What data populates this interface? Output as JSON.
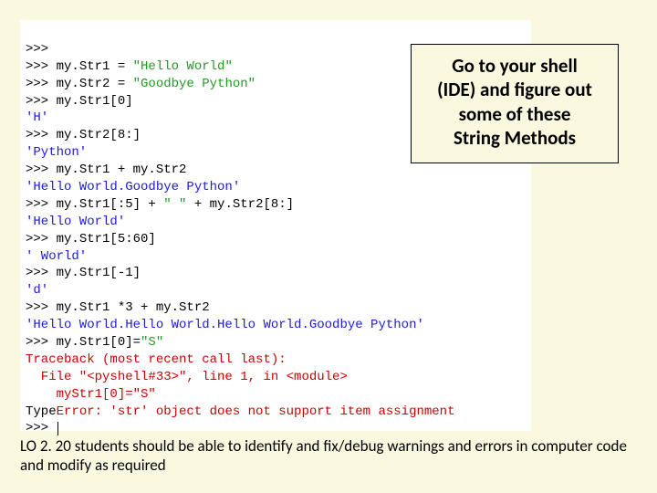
{
  "code": {
    "prompt": ">>> ",
    "l1a": "my.Str1 = ",
    "l1b": "\"Hello World\"",
    "l2a": "my.Str2 = ",
    "l2b": "\"Goodbye Python\"",
    "l3": "my.Str1[0]",
    "o3": "'H'",
    "l4": "my.Str2[8:]",
    "o4": "'Python'",
    "l5": "my.Str1 + my.Str2",
    "o5": "'Hello World.Goodbye Python'",
    "l6a": "my.Str1[:5] + ",
    "l6b": "\" \"",
    "l6c": " + my.Str2[8:]",
    "o6": "'Hello World'",
    "l7": "my.Str1[5:60]",
    "o7": "' World'",
    "l8": "my.Str1[-1]",
    "o8": "'d'",
    "l9": "my.Str1 *3 + my.Str2",
    "o9": "'Hello World.Hello World.Hello World.Goodbye Python'",
    "l10a": "my.Str1[0]=",
    "l10b": "\"S\"",
    "err1": "Traceback (most recent call last):",
    "err2": "  File \"<pyshell#33>\", line 1, in <module>",
    "err3": "    myStr1[0]=\"S\"",
    "err4a": "Type",
    "err4b": "Error: 'str' object does not support item assignment"
  },
  "callout": {
    "line1": "Go to your shell",
    "line2": "(IDE) and figure out",
    "line3": "some of these",
    "line4": "String Methods"
  },
  "footer": {
    "text": "LO 2. 20 students should be able to identify and fix/debug warnings and errors in computer code and modify as required"
  }
}
